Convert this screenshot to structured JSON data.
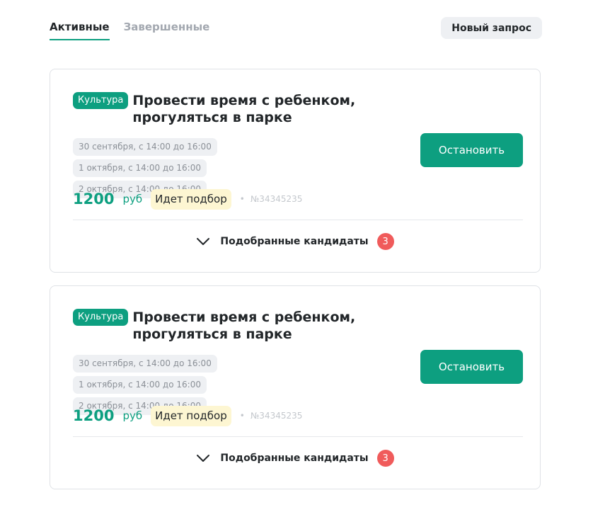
{
  "tabs": {
    "active_label": "Активные",
    "completed_label": "Завершенные"
  },
  "new_request_label": "Новый запрос",
  "colors": {
    "accent": "#0d9f80",
    "status_bg": "#fdf6d2",
    "count_badge": "#f05b5b"
  },
  "requests": [
    {
      "category": "Культура",
      "title": "Провести время с ребенком, прогуляться в парке",
      "dates": [
        "30 сентября, с 14:00 до 16:00",
        "1 октября, с 14:00 до 16:00",
        "2 октября, с 14:00 до 16:00"
      ],
      "price": "1200",
      "currency": "руб",
      "status": "Идет подбор",
      "separator": "•",
      "number": "№34345235",
      "stop_label": "Остановить",
      "candidates_label": "Подобранные кандидаты",
      "candidates_count": "3",
      "candidates_icon": "chevron-down-icon"
    },
    {
      "category": "Культура",
      "title": "Провести время с ребенком, прогуляться в парке",
      "dates": [
        "30 сентября, с 14:00 до 16:00",
        "1 октября, с 14:00 до 16:00",
        "2 октября, с 14:00 до 16:00"
      ],
      "price": "1200",
      "currency": "руб",
      "status": "Идет подбор",
      "separator": "•",
      "number": "№34345235",
      "stop_label": "Остановить",
      "candidates_label": "Подобранные кандидаты",
      "candidates_count": "3",
      "candidates_icon": "chevron-down-icon"
    }
  ]
}
